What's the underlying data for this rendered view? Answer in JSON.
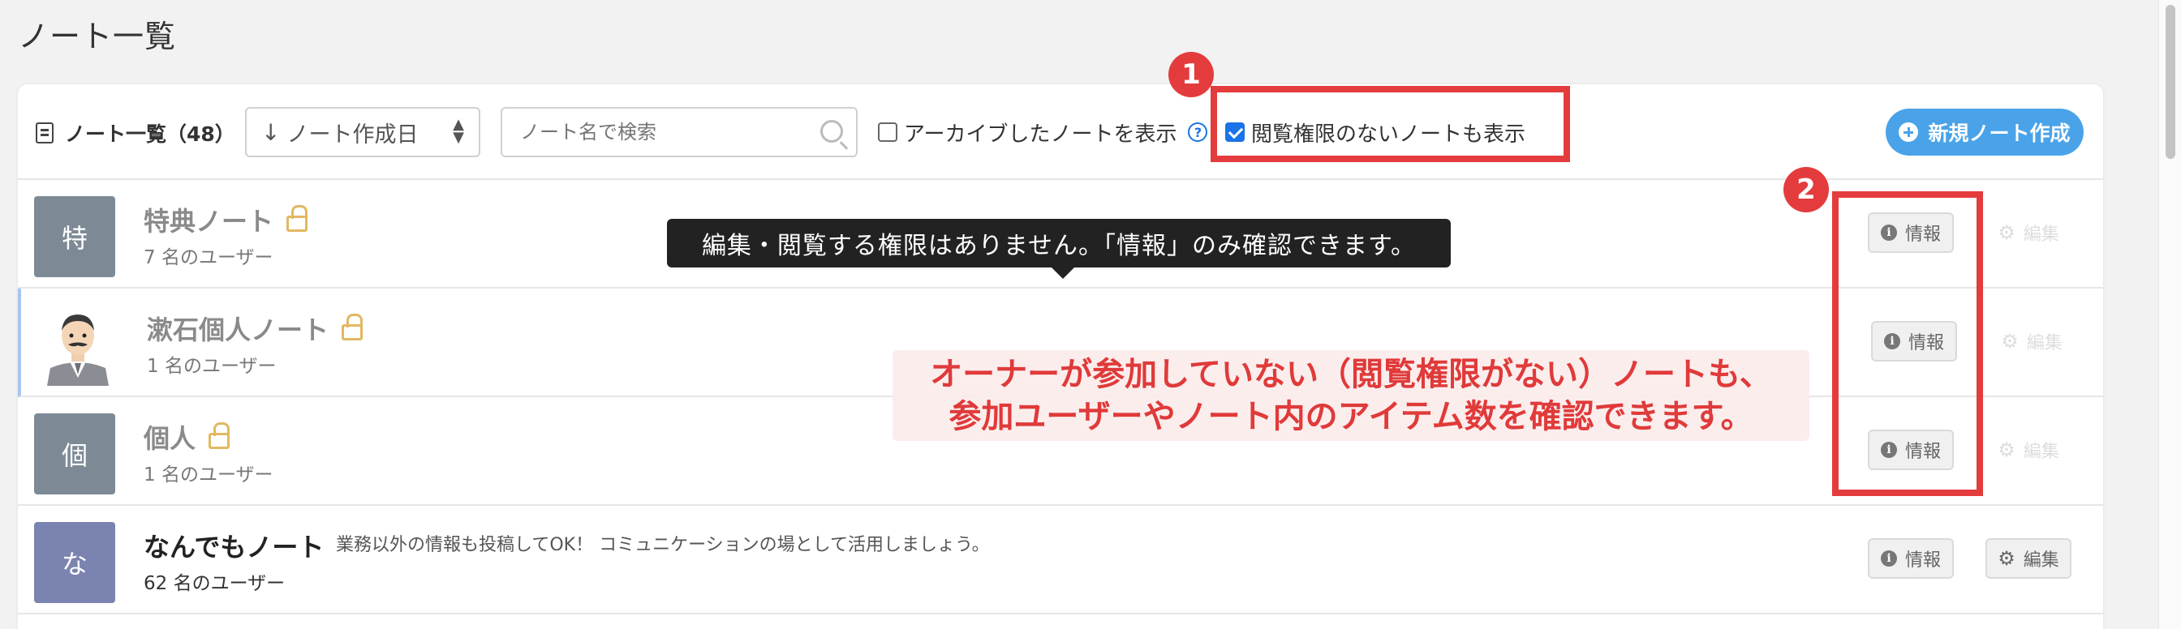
{
  "page_title": "ノート一覧",
  "toolbar": {
    "list_title": "ノート一覧（48）",
    "sort_arrow": "↓",
    "sort_label": "ノート作成日",
    "search_placeholder": "ノート名で検索",
    "archive_label": "アーカイブしたノートを表示",
    "help_mark": "?",
    "noperm_label": "閲覧権限のないノートも表示",
    "new_note_label": "新規ノート作成"
  },
  "notes": [
    {
      "avatar": "特",
      "name": "特典ノート",
      "users": "7 名のユーザー",
      "locked": true
    },
    {
      "avatar": "",
      "name": "漱石個人ノート",
      "users": "1 名のユーザー",
      "locked": true
    },
    {
      "avatar": "個",
      "name": "個人",
      "users": "1 名のユーザー",
      "locked": true
    },
    {
      "avatar": "な",
      "name": "なんでもノート",
      "users": "62 名のユーザー",
      "desc": "業務以外の情報も投稿してOK！ コミュニケーションの場として活用しましょう。",
      "locked": false
    }
  ],
  "buttons": {
    "info": "情報",
    "edit": "編集"
  },
  "tooltip": "編集・閲覧する権限はありません。「情報」のみ確認できます。",
  "annotations": {
    "badge_1": "1",
    "badge_2": "2",
    "callout_line1": "オーナーが参加していない（閲覧権限がない）ノートも、",
    "callout_line2": "参加ユーザーやノート内のアイテム数を確認できます。"
  },
  "colors": {
    "accent": "#4aa3e8",
    "highlight": "#e43c3c",
    "lock": "#e2b860"
  }
}
